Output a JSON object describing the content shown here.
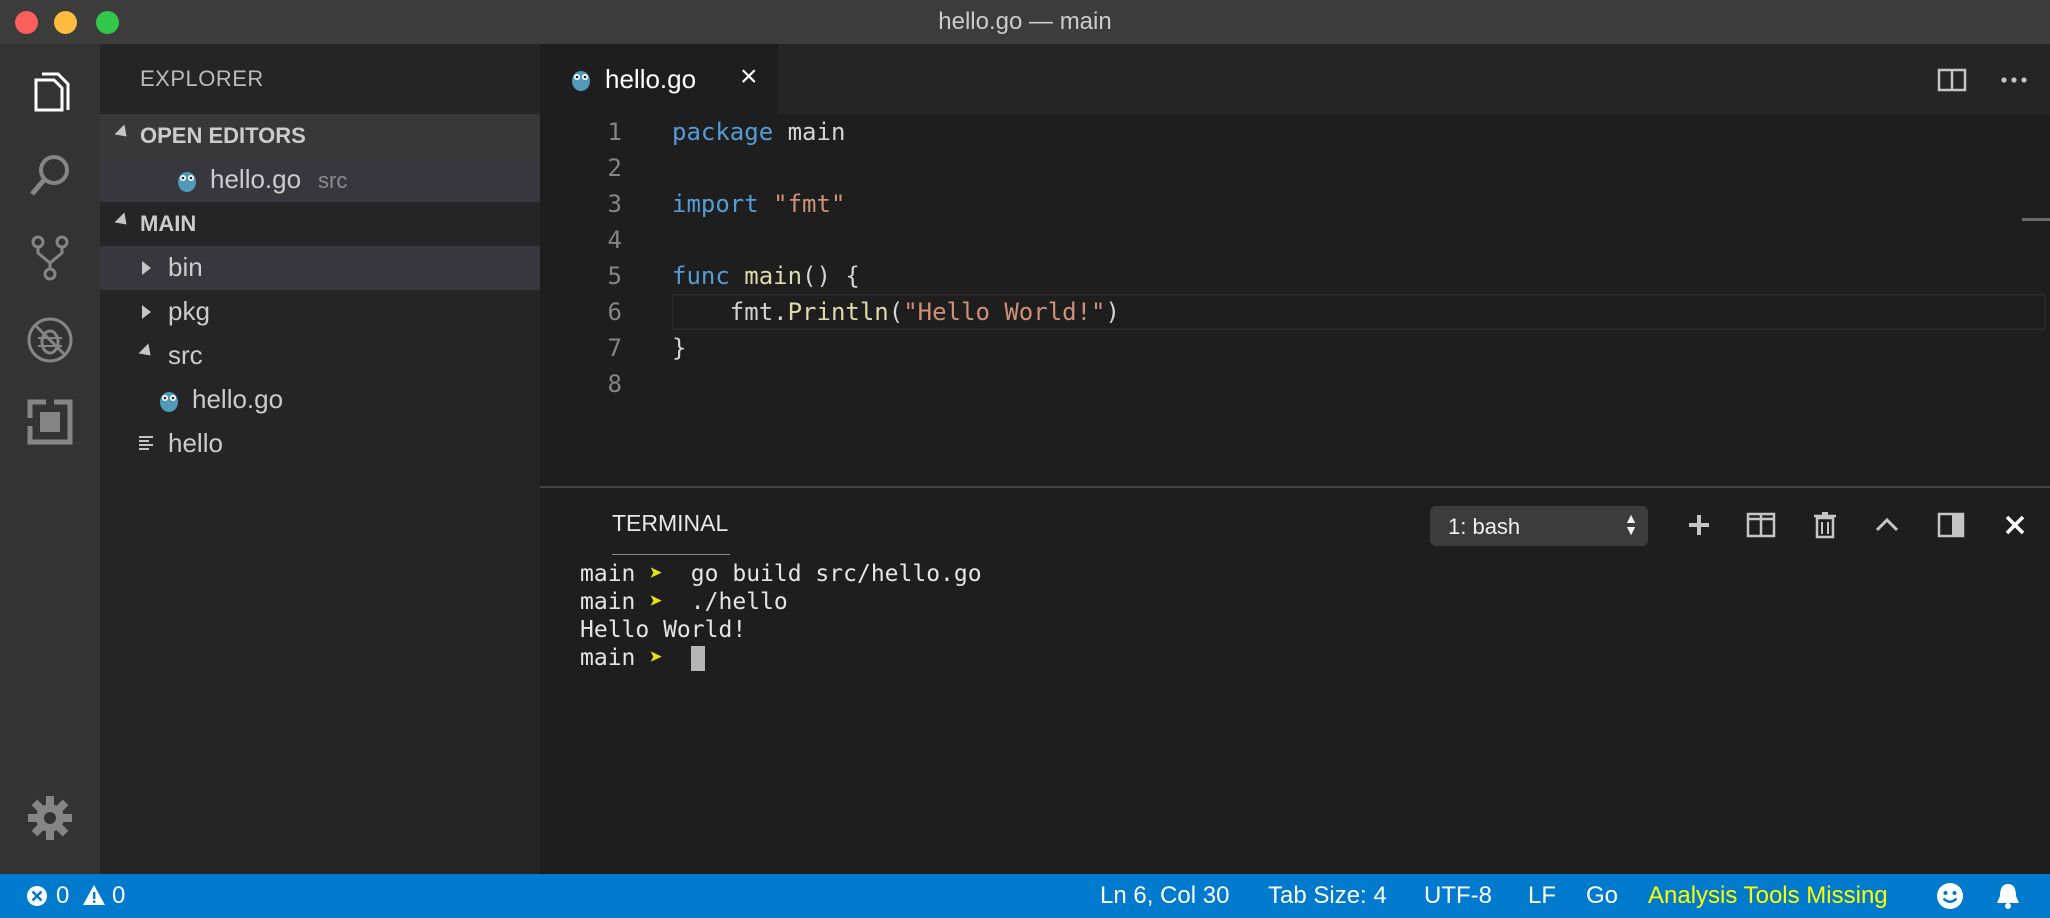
{
  "window": {
    "title": "hello.go — main"
  },
  "sidebar": {
    "title": "EXPLORER",
    "open_editors": {
      "header": "OPEN EDITORS",
      "items": [
        {
          "name": "hello.go",
          "folder": "src"
        }
      ]
    },
    "workspace": {
      "header": "MAIN",
      "tree": [
        {
          "name": "bin"
        },
        {
          "name": "pkg"
        },
        {
          "name": "src"
        },
        {
          "name": "hello.go"
        },
        {
          "name": "hello"
        }
      ]
    }
  },
  "editor": {
    "tab": {
      "label": "hello.go",
      "close": "×"
    },
    "line_numbers": [
      "1",
      "2",
      "3",
      "4",
      "5",
      "6",
      "7",
      "8"
    ],
    "code": {
      "l1_kw": "package",
      "l1_rest": " main",
      "l3_kw": "import",
      "l3_str": "\"fmt\"",
      "l5_kw": "func",
      "l5_fn": "main",
      "l5_rest": "() {",
      "l6_obj": "    fmt.",
      "l6_fn": "Println",
      "l6_open": "(",
      "l6_str": "\"Hello World!\"",
      "l6_close": ")",
      "l7": "}"
    }
  },
  "terminal": {
    "title": "TERMINAL",
    "selected_shell": "1: bash",
    "lines": [
      {
        "prompt": "main",
        "arrow": "➤",
        "cmd": "  go build src/hello.go"
      },
      {
        "prompt": "main",
        "arrow": "➤",
        "cmd": "  ./hello"
      },
      {
        "output": "Hello World!"
      },
      {
        "prompt": "main",
        "arrow": "➤"
      }
    ]
  },
  "statusbar": {
    "errors": "0",
    "warnings": "0",
    "position": "Ln 6, Col 30",
    "tab_size": "Tab Size: 4",
    "encoding": "UTF-8",
    "eol": "LF",
    "language": "Go",
    "warning_message": "Analysis Tools Missing"
  },
  "colors": {
    "statusbar": "#007acc",
    "keyword": "#569cd6",
    "string": "#ce9178",
    "function": "#dcdcaa",
    "prompt_arrow": "#e5e510",
    "warning_text": "#ffff00"
  }
}
